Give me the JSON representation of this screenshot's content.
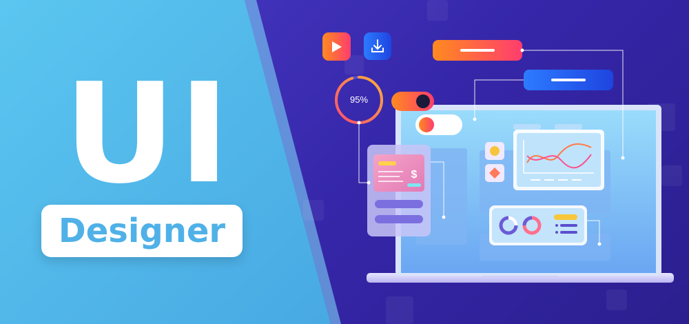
{
  "banner": {
    "headline": "UI",
    "subtitle": "Designer"
  },
  "illustration": {
    "progress_label": "95%",
    "progress_value": 0.95,
    "price_symbol": "$",
    "icons": [
      "play-icon",
      "download-icon",
      "dollar-icon"
    ],
    "colors": {
      "left_panel": "#5bc0ec",
      "right_bg": "#3a2fb5",
      "accent_orange": "#ff6a3d",
      "accent_blue": "#2962ff",
      "screen": "#8fd3fa"
    }
  }
}
